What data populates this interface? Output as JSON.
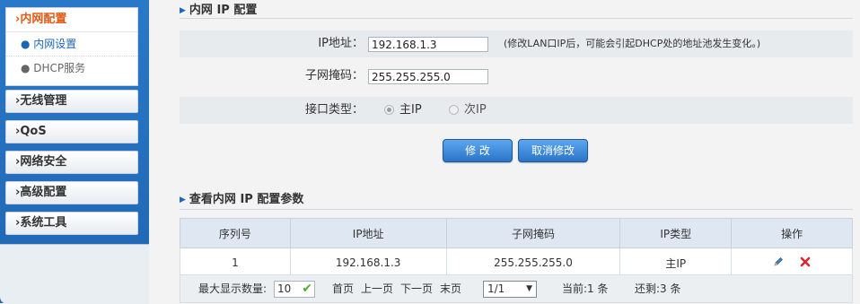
{
  "sidebar": {
    "active_group": "›内网配置",
    "sub_items": [
      "● 内网设置",
      "● DHCP服务"
    ],
    "menu_items": [
      "›无线管理",
      "›QoS",
      "›网络安全",
      "›高级配置",
      "›系统工具"
    ]
  },
  "lan_config": {
    "title": "内网 IP 配置",
    "ip_label": "IP地址：",
    "ip_value": "192.168.1.3",
    "ip_note": "(修改LAN口IP后，可能会引起DHCP处的地址池发生变化。)",
    "mask_label": "子网掩码：",
    "mask_value": "255.255.255.0",
    "iface_type_label": "接口类型：",
    "iface_primary": "主IP",
    "iface_secondary": "次IP",
    "modify_button": "修 改",
    "cancel_button": "取消修改"
  },
  "params": {
    "title": "查看内网 IP 配置参数",
    "columns": [
      "序列号",
      "IP地址",
      "子网掩码",
      "IP类型",
      "操作"
    ],
    "rows": [
      {
        "index": "1",
        "ip": "192.168.1.3",
        "mask": "255.255.255.0",
        "type": "主IP"
      }
    ]
  },
  "pager": {
    "max_display_label": "最大显示数量:",
    "max_display_value": "10",
    "first": "首页",
    "prev": "上一页",
    "next": "下一页",
    "last": "末页",
    "page_select": "1/1",
    "current_count": "当前:1 条",
    "remaining_count": "还剩:3 条"
  },
  "colors": {
    "sidebar_blue": "#1f66b3",
    "active_orange": "#e05b17",
    "button_blue": "#2a74c8"
  }
}
